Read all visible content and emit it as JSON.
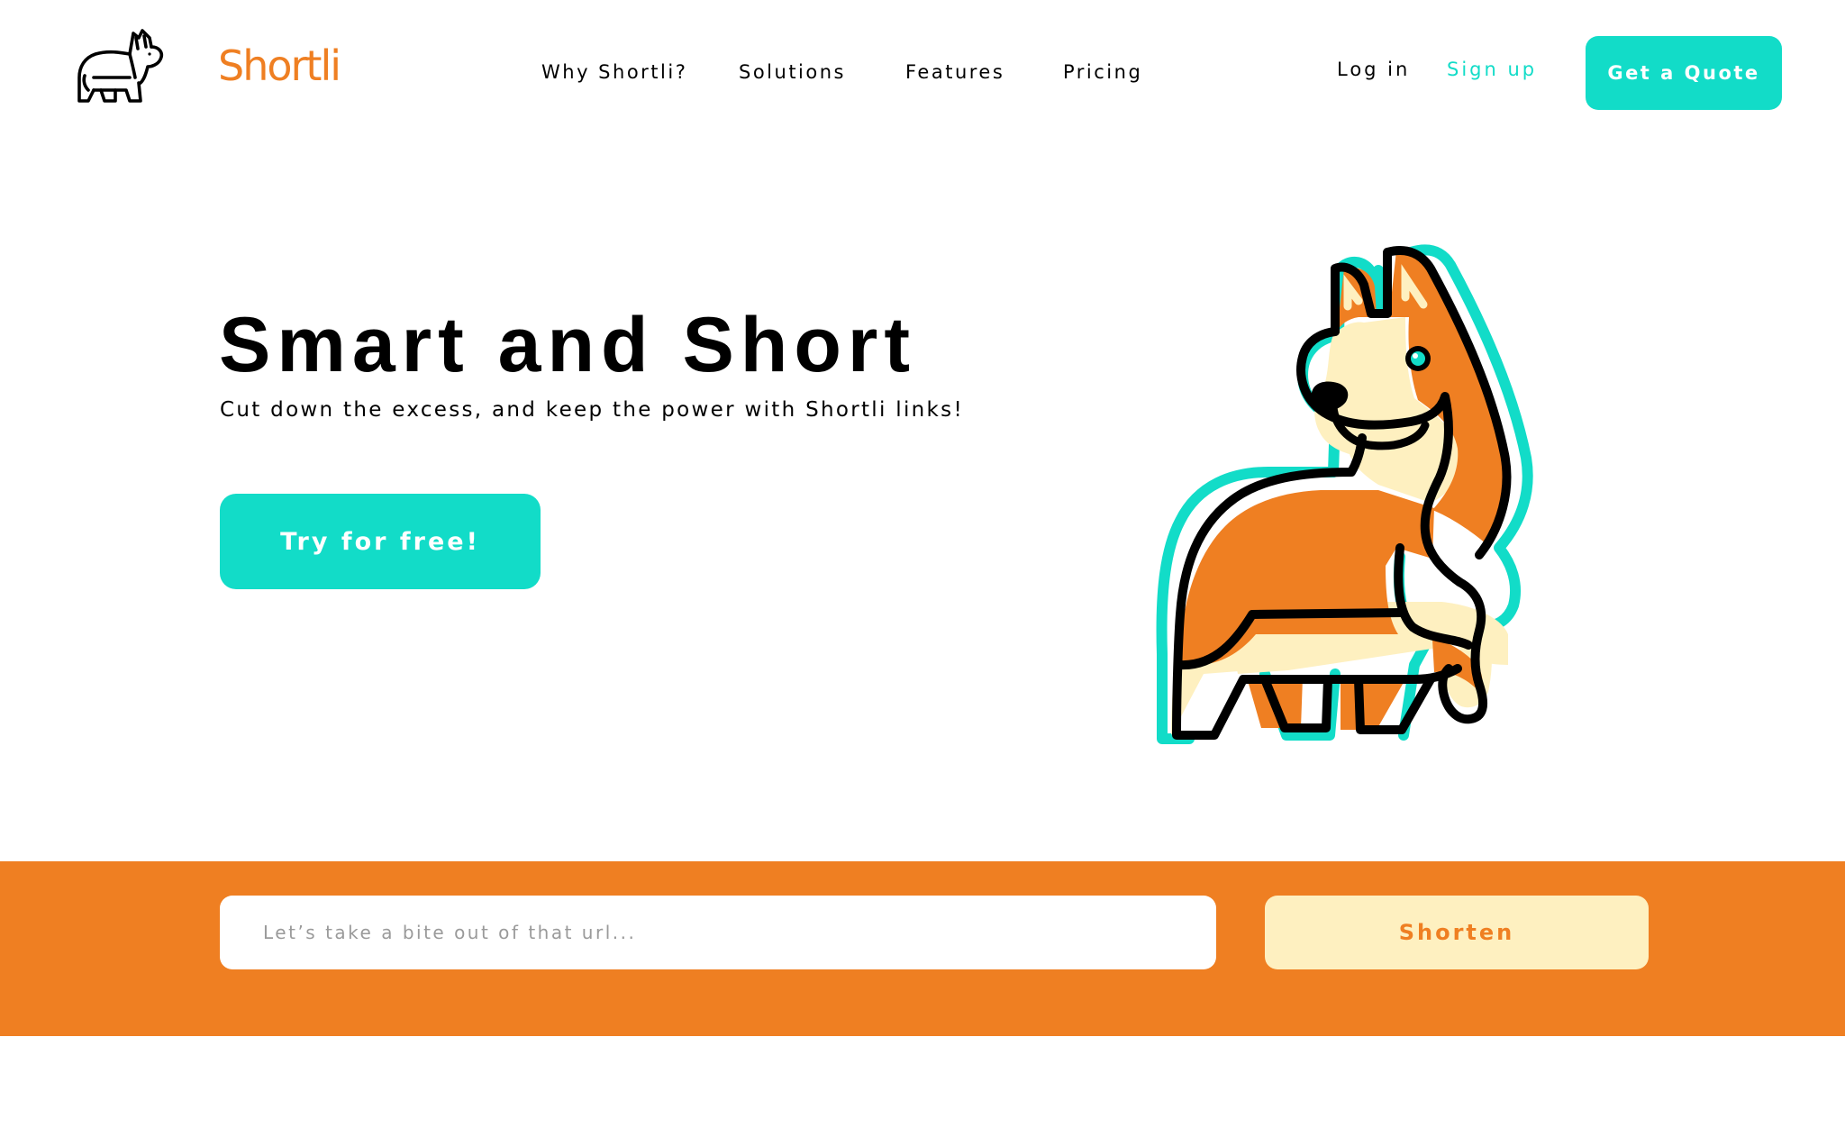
{
  "brand": {
    "name": "Shortli",
    "logo_icon": "corgi-outline-icon",
    "colors": {
      "accent_teal": "#12DCC8",
      "brand_orange": "#EF7F22",
      "cream": "#FEF0C0"
    }
  },
  "nav": {
    "items": [
      {
        "label": "Why Shortli?"
      },
      {
        "label": "Solutions"
      },
      {
        "label": "Features"
      },
      {
        "label": "Pricing"
      }
    ]
  },
  "auth": {
    "login_label": "Log in",
    "signup_label": "Sign up",
    "quote_label": "Get a Quote"
  },
  "hero": {
    "title": "Smart and Short",
    "subtitle": "Cut down the excess, and keep the power with Shortli links!",
    "cta_label": "Try for free!",
    "illustration": "corgi-illustration"
  },
  "shorten": {
    "placeholder": "Let’s take a bite out of that url...",
    "value": "",
    "button_label": "Shorten"
  }
}
